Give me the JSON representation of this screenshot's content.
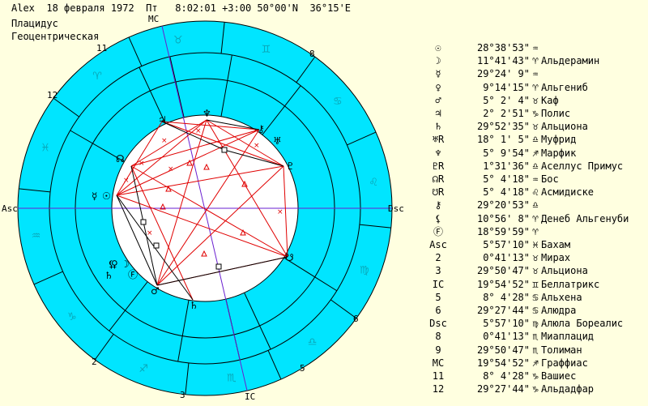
{
  "header": {
    "line1": "Alex  18 февраля 1972  Пт   8:02:01 +3:00 50°00'N  36°15'E",
    "line2": "Плацидус",
    "line3": "Геоцентрическая"
  },
  "colors": {
    "background": "#ffffe0",
    "ring": "#00e5ff",
    "inner": "#ffffff",
    "aspect_red": "#e00000",
    "aspect_black": "#000000",
    "axis": "#6a1fd0"
  },
  "axes": {
    "asc": "Asc",
    "dsc": "Dsc",
    "mc": "MC",
    "ic": "IC"
  },
  "house_numbers": [
    "2",
    "3",
    "5",
    "6",
    "8",
    "11",
    "12"
  ],
  "zodiac_glyphs": [
    "♓",
    "♈",
    "♉",
    "♊",
    "♋",
    "♌",
    "♍",
    "♎",
    "♏",
    "♐",
    "♑",
    "♒"
  ],
  "planet_glyphs": {
    "sun": "☉",
    "mercury": "☿",
    "venus": "♀",
    "moon": "☽",
    "mars": "♂",
    "jupiter": "♃",
    "saturn": "♄",
    "uranus": "♅",
    "neptune": "♆",
    "pluto": "♇",
    "node": "☊",
    "south_node": "☋",
    "chiron": "⚷",
    "fortune": "Ⓕ",
    "lilith": "⚸"
  },
  "table": [
    {
      "sym": "☉",
      "deg": "28°38'53\"",
      "sign": "♒",
      "name": ""
    },
    {
      "sym": "☽",
      "deg": "11°41'43\"",
      "sign": "♈",
      "name": "Альдерамин"
    },
    {
      "sym": "☿",
      "deg": "29°24' 9\"",
      "sign": "♒",
      "name": ""
    },
    {
      "sym": "♀",
      "deg": "9°14'15\"",
      "sign": "♈",
      "name": "Альгениб"
    },
    {
      "sym": "♂",
      "deg": "5° 2' 4\"",
      "sign": "♉",
      "name": "Каф"
    },
    {
      "sym": "♃",
      "deg": "2° 2'51\"",
      "sign": "♑",
      "name": "Полис"
    },
    {
      "sym": "♄",
      "deg": "29°52'35\"",
      "sign": "♉",
      "name": "Альциона"
    },
    {
      "sym": "♅R",
      "deg": "18° 1' 5\"",
      "sign": "♎",
      "name": "Муфрид"
    },
    {
      "sym": "♆",
      "deg": "5° 9'54\"",
      "sign": "♐",
      "name": "Марфик"
    },
    {
      "sym": "♇R",
      "deg": "1°31'36\"",
      "sign": "♎",
      "name": "Аселлус Примус"
    },
    {
      "sym": "☊R",
      "deg": "5° 4'18\"",
      "sign": "♒",
      "name": "Бос"
    },
    {
      "sym": "☋R",
      "deg": "5° 4'18\"",
      "sign": "♌",
      "name": "Асмидиске"
    },
    {
      "sym": "⚷",
      "deg": "29°20'53\"",
      "sign": "♎",
      "name": ""
    },
    {
      "sym": "⚸",
      "deg": "10°56' 8\"",
      "sign": "♈",
      "name": "Денеб Альгенуби"
    },
    {
      "sym": "Ⓕ",
      "deg": "18°59'59\"",
      "sign": "♈",
      "name": ""
    },
    {
      "sym": "Asc",
      "deg": "5°57'10\"",
      "sign": "♓",
      "name": "Бахам"
    },
    {
      "sym": "2",
      "deg": "0°41'13\"",
      "sign": "♉",
      "name": "Мирах"
    },
    {
      "sym": "3",
      "deg": "29°50'47\"",
      "sign": "♉",
      "name": "Альциона"
    },
    {
      "sym": "IC",
      "deg": "19°54'52\"",
      "sign": "♊",
      "name": "Беллатрикс"
    },
    {
      "sym": "5",
      "deg": "8° 4'28\"",
      "sign": "♋",
      "name": "Альхена"
    },
    {
      "sym": "6",
      "deg": "29°27'44\"",
      "sign": "♋",
      "name": "Алюдра"
    },
    {
      "sym": "Dsc",
      "deg": "5°57'10\"",
      "sign": "♍",
      "name": "Алюла Бореалис"
    },
    {
      "sym": "8",
      "deg": "0°41'13\"",
      "sign": "♏",
      "name": "Миаплацид"
    },
    {
      "sym": "9",
      "deg": "29°50'47\"",
      "sign": "♏",
      "name": "Толиман"
    },
    {
      "sym": "MC",
      "deg": "19°54'52\"",
      "sign": "♐",
      "name": "Граффиас"
    },
    {
      "sym": "11",
      "deg": "8° 4'28\"",
      "sign": "♑",
      "name": "Вашиес"
    },
    {
      "sym": "12",
      "deg": "29°27'44\"",
      "sign": "♑",
      "name": "Альдадфар"
    }
  ]
}
